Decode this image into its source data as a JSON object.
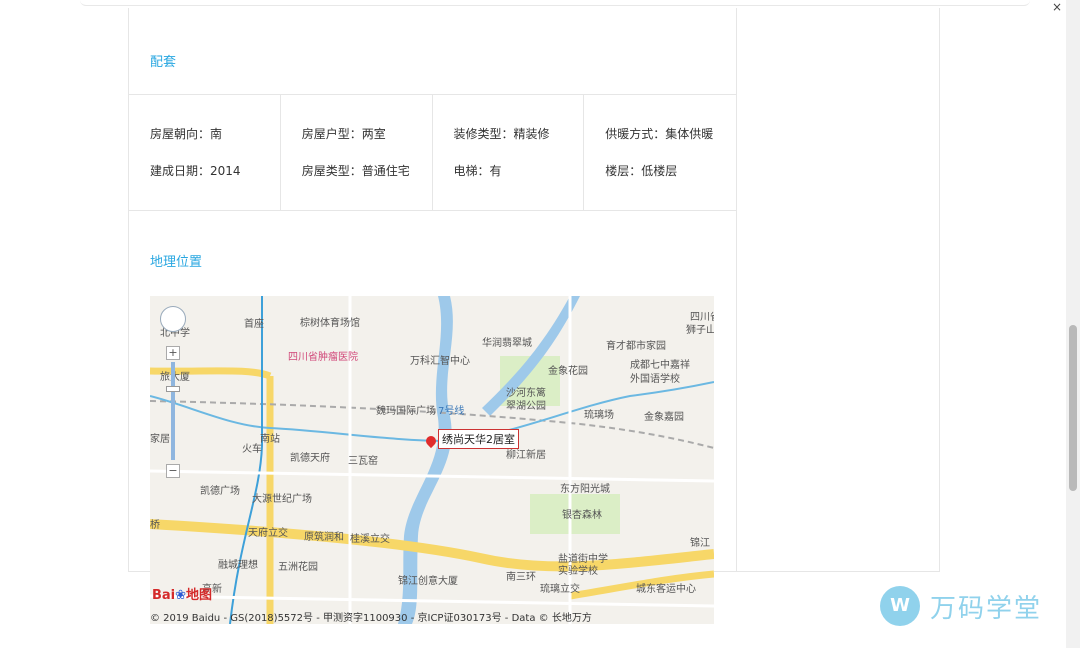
{
  "top": {
    "close_glyph": "×"
  },
  "sections": {
    "facilities_title": "配套",
    "location_title": "地理位置"
  },
  "attributes": [
    [
      "房屋朝向：南",
      "建成日期：2014"
    ],
    [
      "房屋户型：两室",
      "房屋类型：普通住宅"
    ],
    [
      "装修类型：精装修",
      "电梯：有"
    ],
    [
      "供暖方式：集体供暖",
      "楼层：低楼层"
    ]
  ],
  "map": {
    "pin_label": "绣尚天华2居室",
    "labels": [
      {
        "text": "北中学",
        "style": ""
      },
      {
        "text": "首座",
        "style": ""
      },
      {
        "text": "棕树体育场馆",
        "style": ""
      },
      {
        "text": "四川省肿瘤医院",
        "style": "pink"
      },
      {
        "text": "万科汇智中心",
        "style": ""
      },
      {
        "text": "华润翡翠城",
        "style": ""
      },
      {
        "text": "育才都市家园",
        "style": ""
      },
      {
        "text": "四川省",
        "style": ""
      },
      {
        "text": "狮子山",
        "style": ""
      },
      {
        "text": "旅大厦",
        "style": ""
      },
      {
        "text": "金象花园",
        "style": ""
      },
      {
        "text": "成都七中嘉祥",
        "style": ""
      },
      {
        "text": "外国语学校",
        "style": ""
      },
      {
        "text": "魏玛国际广场",
        "style": ""
      },
      {
        "text": "7号线",
        "style": "blue"
      },
      {
        "text": "沙河东篱",
        "style": ""
      },
      {
        "text": "翠湖公园",
        "style": ""
      },
      {
        "text": "琉璃场",
        "style": ""
      },
      {
        "text": "金象嘉园",
        "style": ""
      },
      {
        "text": "家居",
        "style": ""
      },
      {
        "text": "南站",
        "style": ""
      },
      {
        "text": "火车",
        "style": ""
      },
      {
        "text": "凯德天府",
        "style": ""
      },
      {
        "text": "三瓦窑",
        "style": ""
      },
      {
        "text": "柳江新居",
        "style": ""
      },
      {
        "text": "凯德广场",
        "style": ""
      },
      {
        "text": "大源世纪广场",
        "style": ""
      },
      {
        "text": "东方阳光城",
        "style": ""
      },
      {
        "text": "桥",
        "style": ""
      },
      {
        "text": "天府立交",
        "style": ""
      },
      {
        "text": "原筑润和",
        "style": ""
      },
      {
        "text": "桂溪立交",
        "style": ""
      },
      {
        "text": "银杏森林",
        "style": ""
      },
      {
        "text": "锦江",
        "style": ""
      },
      {
        "text": "融城理想",
        "style": ""
      },
      {
        "text": "五洲花园",
        "style": ""
      },
      {
        "text": "盐道街中学",
        "style": ""
      },
      {
        "text": "实验学校",
        "style": ""
      },
      {
        "text": "高新",
        "style": ""
      },
      {
        "text": "锦江创意大厦",
        "style": ""
      },
      {
        "text": "南三环",
        "style": ""
      },
      {
        "text": "琉璃立交",
        "style": ""
      },
      {
        "text": "城东客运中心",
        "style": ""
      }
    ],
    "copyright": "© 2019 Baidu - GS(2018)5572号 - 甲测资字1100930 - 京ICP证030173号 - Data © 长地万方",
    "logo_text": "Bai",
    "logo_suffix": "地图"
  },
  "watermark": {
    "icon_text": "W",
    "text": "万码学堂"
  },
  "colors": {
    "accent": "#29a7e1",
    "road_yellow": "#f7d768",
    "river": "#9ec9ea",
    "metro": "#6bb8e2"
  }
}
